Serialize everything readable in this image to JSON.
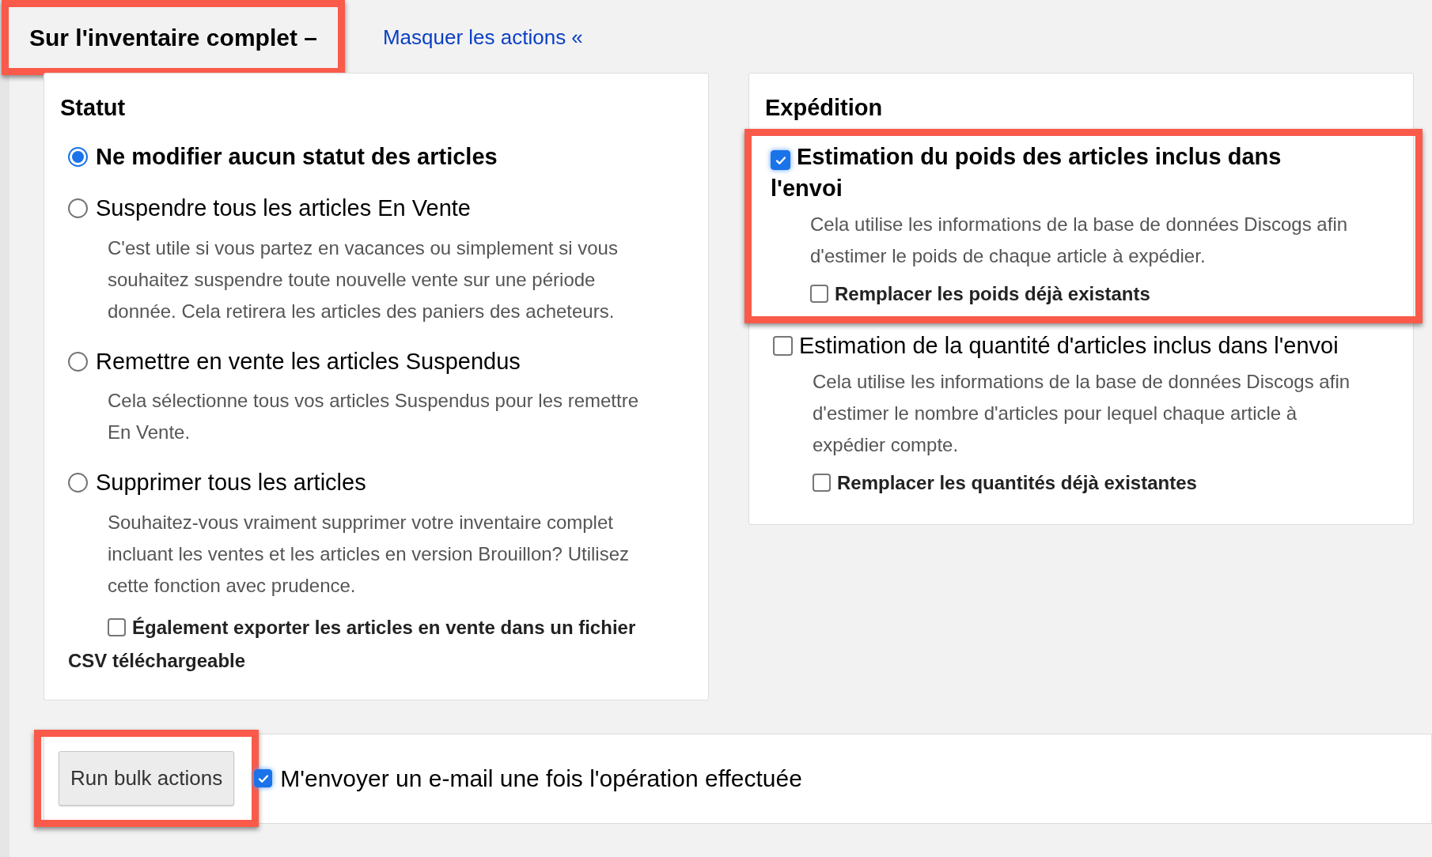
{
  "header": {
    "title": "Sur l'inventaire complet –",
    "highlighted": true,
    "toggle_link": "Masquer les actions «"
  },
  "status": {
    "heading": "Statut",
    "options": [
      {
        "label": "Ne modifier aucun statut des articles",
        "selected": true
      },
      {
        "label": "Suspendre tous les articles En Vente",
        "selected": false,
        "description": "C'est utile si vous partez en vacances ou simplement si vous souhaitez suspendre toute nouvelle vente sur une période donnée. Cela retirera les articles des paniers des acheteurs."
      },
      {
        "label": "Remettre en vente les articles Suspendus",
        "selected": false,
        "description": "Cela sélectionne tous vos articles Suspendus pour les remettre En Vente."
      },
      {
        "label": "Supprimer tous les articles",
        "selected": false,
        "description": "Souhaitez-vous vraiment supprimer votre inventaire complet incluant les ventes et les articles en version Brouillon? Utilisez cette fonction avec prudence.",
        "option": {
          "label": "Également exporter les articles en vente dans un fichier CSV téléchargeable",
          "checked": false
        }
      }
    ]
  },
  "shipping": {
    "heading": "Expédition",
    "options": [
      {
        "label": "Estimation du poids des articles inclus dans l'envoi",
        "checked": true,
        "highlighted": true,
        "description": "Cela utilise les informations de la base de données Discogs afin d'estimer le poids de chaque article à expédier.",
        "option": {
          "label": "Remplacer les poids déjà existants",
          "checked": false
        }
      },
      {
        "label": "Estimation de la quantité d'articles inclus dans l'envoi",
        "checked": false,
        "highlighted": false,
        "description": "Cela utilise les informations de la base de données Discogs afin d'estimer le nombre d'articles pour lequel chaque article à expédier compte.",
        "option": {
          "label": "Remplacer les quantités déjà existantes",
          "checked": false
        }
      }
    ]
  },
  "footer": {
    "button": {
      "label": "Run bulk actions",
      "highlighted": true
    },
    "email": {
      "label": "M'envoyer un e-mail une fois l'opération effectuée",
      "checked": true
    }
  }
}
